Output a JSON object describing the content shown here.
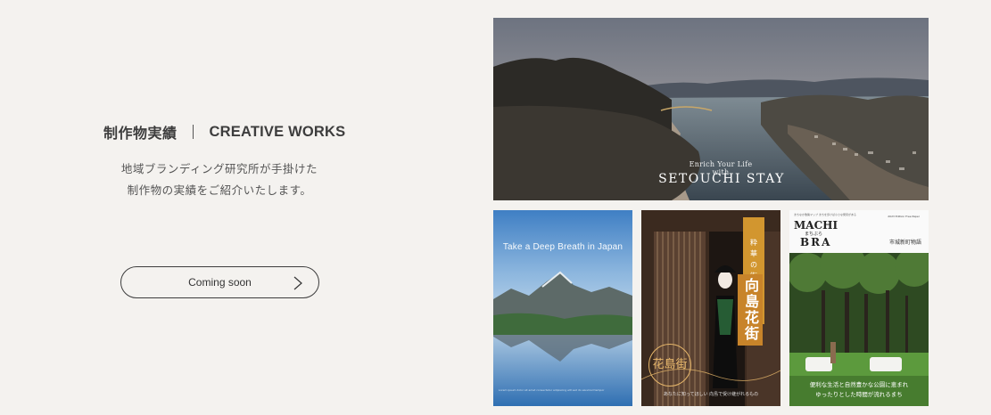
{
  "section": {
    "title_ja": "制作物実績",
    "title_en": "CREATIVE WORKS",
    "description_lines": [
      "地域ブランディング研究所が手掛けた",
      "制作物の実績をご紹介いたします。"
    ],
    "cta_label": "Coming soon",
    "cta_icon": "chevron-right-icon"
  },
  "works": {
    "hero": {
      "caption_small": "Enrich Your Life with",
      "caption_large": "SETOUCHI STAY"
    },
    "poster1": {
      "title": "Take a Deep Breath in Japan",
      "fine_print": "Lorem ipsum dolor sit amet consectetur adipiscing elit sed do eiusmod tempor"
    },
    "poster2": {
      "tag": "粋 華 の 街 並 を",
      "main": "向島花街",
      "emblem": "花島街",
      "sub": "あなたに知ってほしい 向島で受け継がれるもの"
    },
    "poster3": {
      "tiny_header": "まちなか散策マップ まちを歩けば小さな発見がある",
      "issue": "2023 Edition\nFree Paper",
      "machi": "MACHI",
      "kana": "まちぶら",
      "bra": "BRA",
      "right_label": "市城新町物語",
      "caption_line1": "便利な生活と自然豊かな公園に恵まれ",
      "caption_line2": "ゆったりとした時間が流れるまち"
    }
  }
}
